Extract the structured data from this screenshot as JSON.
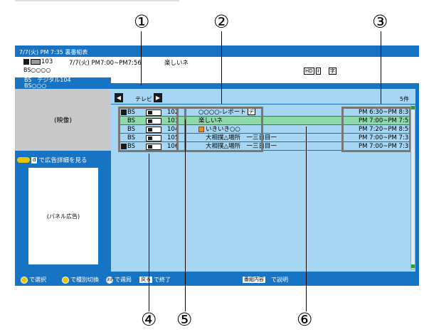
{
  "callouts": {
    "c1": "①",
    "c2": "②",
    "c3": "③",
    "c4": "④",
    "c5": "⑤",
    "c6": "⑥"
  },
  "screen": {
    "title": "7/7(火) PM  7:35 裏番組表",
    "now": {
      "channel": "103",
      "time": "7/7(火)  PM7:00~PM7:56",
      "program": "楽しいネ",
      "line2": "BS○○○○",
      "hd_badge": "HD",
      "badge2": "ｷ",
      "badge3": "字",
      "line3": "BS　デジタル104",
      "line4": "BS○○○"
    },
    "video_label": "(映像)",
    "ad_link": "で広告詳細を見る",
    "ad_key": "d",
    "panel_label": "(パネル広告)",
    "nav": {
      "prev_icon": "◀",
      "label": "テレビ",
      "next_icon": "▶",
      "count": "5件"
    },
    "rows": [
      {
        "net": "BS",
        "ch": "102",
        "title": "○○○○-レポート",
        "badge1": "映",
        "badge2": "デ",
        "time": "PM  6:30~PM  8:30"
      },
      {
        "net": "BS",
        "ch": "103",
        "title": "楽しいネ",
        "badge1": "",
        "badge2": "",
        "time": "PM  7:00~PM  7:56"
      },
      {
        "net": "BS",
        "ch": "104",
        "title": "いきいき○○",
        "badge1": "",
        "badge2": "",
        "time": "PM  7:20~PM  8:50"
      },
      {
        "net": "BS",
        "ch": "105",
        "title": "大相撲△場所　一三日目一",
        "badge1": "",
        "badge2": "",
        "time": "PM  7:00~PM  7:30"
      },
      {
        "net": "BS",
        "ch": "106",
        "title": "大相撲△場所　一三日目一",
        "badge1": "",
        "badge2": "",
        "time": "PM  7:00~PM  7:30"
      }
    ],
    "footer": {
      "select": "で選択",
      "switch": "で種別切換",
      "week": "で週局",
      "back_key": "戻る",
      "end": "で終了",
      "info_key": "番組内容",
      "info": "で説明"
    }
  }
}
